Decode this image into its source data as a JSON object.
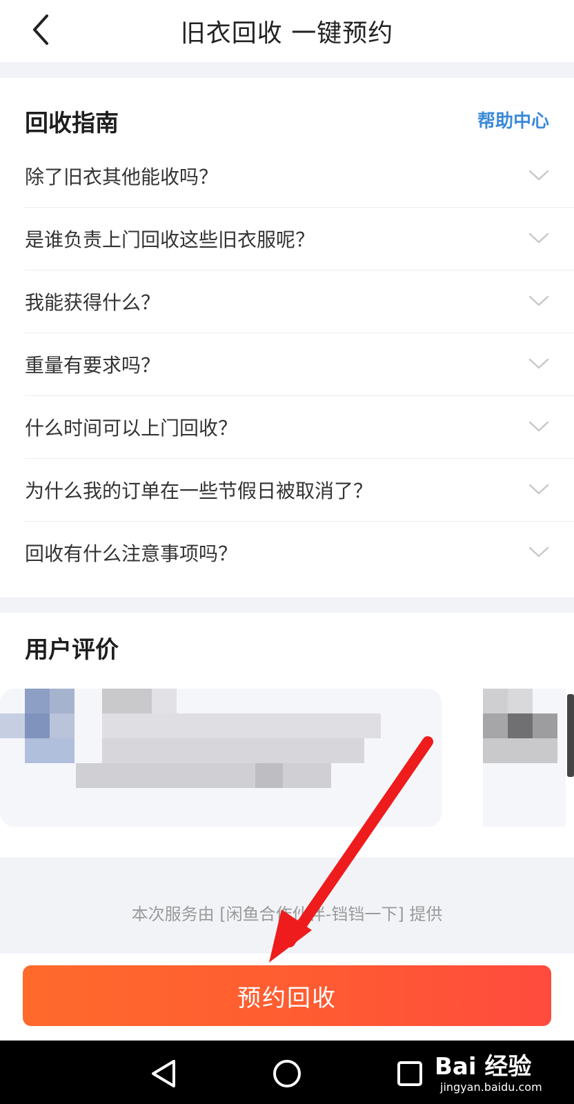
{
  "header": {
    "title": "旧衣回收 一键预约"
  },
  "guide": {
    "title": "回收指南",
    "help_link": "帮助中心",
    "faqs": [
      "除了旧衣其他能收吗？",
      "是谁负责上门回收这些旧衣服呢？",
      "我能获得什么？",
      "重量有要求吗？",
      "什么时间可以上门回收？",
      "为什么我的订单在一些节假日被取消了？",
      "回收有什么注意事项吗？"
    ]
  },
  "reviews": {
    "title": "用户评价"
  },
  "footer": {
    "provider_text": "本次服务由 [闲鱼合作伙伴-铛铛一下] 提供",
    "cta_label": "预约回收"
  },
  "watermark": {
    "brand": "Bai 经验",
    "url": "jingyan.baidu.com"
  },
  "colors": {
    "accent_link": "#3b8ad9",
    "cta_start": "#ff6a2b",
    "cta_end": "#ff4b3e",
    "annotation_arrow": "#ee1c1c"
  }
}
